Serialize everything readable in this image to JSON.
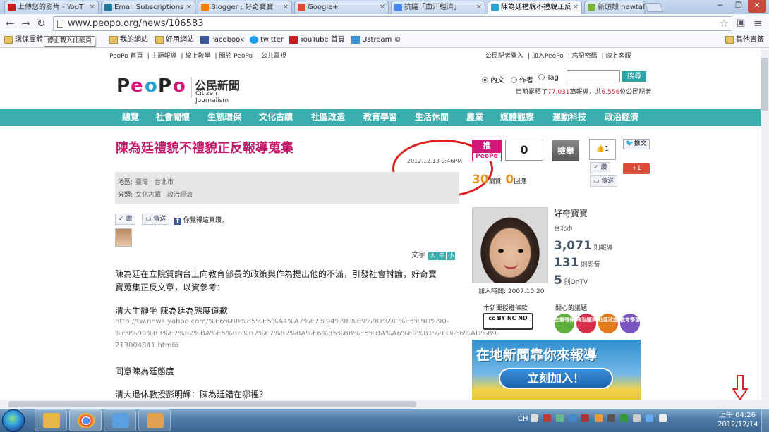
{
  "browser": {
    "tabs": [
      {
        "label": "上傳您的影片 - YouT",
        "icon": "youtube-icon",
        "color": "#cc181e"
      },
      {
        "label": "Email Subscriptions",
        "icon": "wordpress-icon",
        "color": "#21759b"
      },
      {
        "label": "Blogger : 好奇寶寶",
        "icon": "blogger-icon",
        "color": "#f57d00"
      },
      {
        "label": "Google+",
        "icon": "gplus-icon",
        "color": "#dd4b39"
      },
      {
        "label": "抗議「血汗經濟」",
        "icon": "google-icon",
        "color": "#4285f4"
      },
      {
        "label": "陳為廷禮貌不禮貌正反",
        "icon": "peopo-icon",
        "color": "#2aa6d6",
        "active": true
      },
      {
        "label": "新頭殼 newtalk",
        "icon": "newtalk-icon",
        "color": "#7cb342"
      }
    ],
    "url": "www.peopo.org/news/106583",
    "tooltip": "停止載入此網頁",
    "bookmarks": [
      {
        "label": "環保團體"
      },
      {
        "label": "我的網站"
      },
      {
        "label": "好用網站"
      },
      {
        "label": "Facebook"
      },
      {
        "label": "twitter"
      },
      {
        "label": "YouTube 首頁"
      },
      {
        "label": "Ustream ©"
      },
      {
        "label": "其他書籤"
      }
    ]
  },
  "site": {
    "top_links_left": [
      "PeoPo 首頁",
      "主題報導",
      "線上教學",
      "關於 PeoPo",
      "公共電視"
    ],
    "top_links_right": [
      "公民記者登入",
      "加入PeoPo",
      "忘記密碼",
      "線上客服"
    ],
    "logo_letters": [
      "P",
      "e",
      "o",
      "P",
      "o"
    ],
    "logo_cn": "公民新聞",
    "logo_en": "Citizen Journalism",
    "search_options": [
      "內文",
      "作者",
      "Tag"
    ],
    "search_button": "搜尋",
    "stats_prefix": "目前累積了",
    "stats_reports": "77,031",
    "stats_mid": "篇報導，共",
    "stats_reporters": "6,556",
    "stats_suffix": "位公民記者",
    "nav": [
      "總覽",
      "社會關懷",
      "生態環保",
      "文化古蹟",
      "社區改造",
      "教育學習",
      "生活休閒",
      "農業",
      "媒體觀察",
      "運動科技",
      "政治經濟"
    ]
  },
  "article": {
    "title": "陳為廷禮貌不禮貌正反報導蒐集",
    "date": "2012.12.13 9:46PM",
    "location_label": "地區:",
    "location_value": "臺灣　台北市",
    "category_label": "分類:",
    "category_value": "文化古蹟　政治經濟",
    "push_small": "推",
    "share": "傳送",
    "fb_prompt": "你覺得這真讚。",
    "font_label": "文字",
    "font_sizes": [
      "大",
      "中",
      "小"
    ],
    "para1_line1": "陳為廷在立院質詢台上向教育部長的政策與作為提出他的不滿，引發社會討論，好奇寶",
    "para1_line2": "寶蒐集正反文章，以資參考：",
    "link1_title": "清大生靜坐 陳為廷為態度道歉",
    "link1_url1": "http://tw.news.yahoo.com/%E6%B8%85%E5%A4%A7%E7%94%9F%E9%9D%9C%E5%9D%90-",
    "link1_url2": "%E9%99%B3%E7%82%BA%E5%BB%B7%E7%82%BA%E6%85%8B%E5%BA%A6%E9%81%93%E6%AD%89-",
    "link1_url3": "213004841.html",
    "para2": "同意陳為廷態度",
    "para3": "清大退休教授彭明輝：陳為廷錯在哪裡？"
  },
  "sidebar": {
    "push_top": "推",
    "push_bottom": "PeoPo",
    "push_count": "0",
    "report_button": "檢舉",
    "like_count": "1",
    "tweet_label": "推文",
    "gplus_label": "+1",
    "push_small": "讚",
    "share": "傳送",
    "views_count": "30",
    "views_label": "瀏覽",
    "replies_count": "0",
    "replies_label": "回應",
    "user_name": "好奇寶寶",
    "user_location": "台北市",
    "reports_count": "3,071",
    "reports_label": "則報導",
    "comments_count": "131",
    "comments_label": "則影音",
    "ontv_count": "5",
    "ontv_label": "則OnTV",
    "join_date": "加入時間: 2007.10.20",
    "license_title": "本新聞授權條款",
    "license_badge": "cc BY NC ND",
    "topics_title": "關心的議題",
    "topics": [
      {
        "label": "生態環保",
        "color": "#5fae3a"
      },
      {
        "label": "政治經濟",
        "color": "#d4304a"
      },
      {
        "label": "社區改造",
        "color": "#e07a1a"
      },
      {
        "label": "教育學習",
        "color": "#7a55c2"
      }
    ],
    "banner_text": "在地新聞靠你來報導",
    "banner_button": "立刻加入！"
  },
  "taskbar": {
    "ime": "CH",
    "clock_time": "上午 04:26",
    "clock_date": "2012/12/14",
    "apps": [
      {
        "name": "explorer",
        "color": "#e8b84a"
      },
      {
        "name": "chrome",
        "color": "#4caf50"
      },
      {
        "name": "messenger",
        "color": "#5aa0e0"
      },
      {
        "name": "paint",
        "color": "#e0a050"
      }
    ]
  }
}
